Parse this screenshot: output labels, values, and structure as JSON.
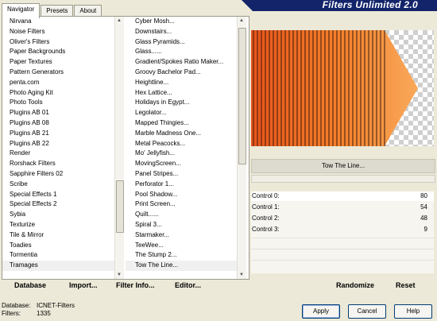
{
  "tabs": [
    "Navigator",
    "Presets",
    "About"
  ],
  "banner": "Filters Unlimited 2.0",
  "categories": [
    "Nirvana",
    "Noise Filters",
    "Oliver's Filters",
    "Paper Backgrounds",
    "Paper Textures",
    "Pattern Generators",
    "penta.com",
    "Photo Aging Kit",
    "Photo Tools",
    "Plugins AB 01",
    "Plugins AB 08",
    "Plugins AB 21",
    "Plugins AB 22",
    "Render",
    "Rorshack Filters",
    "Sapphire Filters 02",
    "Scribe",
    "Special Effects 1",
    "Special Effects 2",
    "Sybia",
    "Texturize",
    "Tile & Mirror",
    "Toadies",
    "Tormentia",
    "Tramages"
  ],
  "filters": [
    "Cyber Mosh...",
    "Downstairs...",
    "Glass Pyramids...",
    "Glass......",
    "Gradient/Spokes Ratio Maker...",
    "Groovy Bachelor Pad...",
    "Heightline...",
    "Hex Lattice...",
    "Holidays in Egypt...",
    "Legolator...",
    "Mapped Thingies...",
    "Marble Madness One...",
    "Metal Peacocks...",
    "Mo' Jellyfish...",
    "MovingScreen...",
    "Panel Stripes...",
    "Perforator 1...",
    "Pool Shadow...",
    "Print Screen...",
    "Quilt......",
    "Spiral 3...",
    "Starmaker...",
    "TeeWee...",
    "The Stump 2...",
    "Tow The Line..."
  ],
  "selected_filter": "Tow The Line...",
  "controls": [
    {
      "name": "Control 0:",
      "value": "80"
    },
    {
      "name": "Control 1:",
      "value": "54"
    },
    {
      "name": "Control 2:",
      "value": "48"
    },
    {
      "name": "Control 3:",
      "value": "9"
    }
  ],
  "bottom_buttons": {
    "database": "Database",
    "import": "Import...",
    "filter_info": "Filter Info...",
    "editor": "Editor...",
    "randomize": "Randomize",
    "reset": "Reset"
  },
  "info": {
    "database_label": "Database:",
    "database_value": "ICNET-Filters",
    "filters_label": "Filters:",
    "filters_value": "1335"
  },
  "dialog_buttons": {
    "apply": "Apply",
    "cancel": "Cancel",
    "help": "Help"
  }
}
